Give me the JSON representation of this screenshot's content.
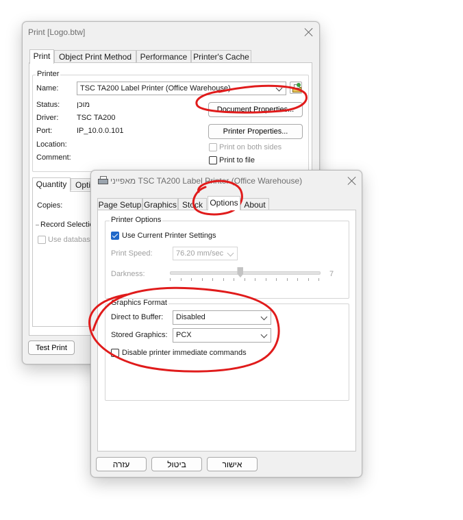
{
  "print_window": {
    "title": "Print [Logo.btw]",
    "tabs": [
      "Print",
      "Object Print Method",
      "Performance",
      "Printer's Cache"
    ],
    "printer_group": "Printer",
    "name_label": "Name:",
    "printer_name": "TSC TA200 Label Printer (Office Warehouse)",
    "status_label": "Status:",
    "status_value": "מוכן",
    "driver_label": "Driver:",
    "driver_value": "TSC TA200",
    "port_label": "Port:",
    "port_value": "IP_10.0.0.101",
    "location_label": "Location:",
    "comment_label": "Comment:",
    "document_properties": "Document Properties...",
    "printer_properties": "Printer Properties...",
    "print_both_sides": "Print on both sides",
    "print_to_file": "Print to file",
    "quantity_tab": "Quantity",
    "options_tab_partial": "Opti",
    "copies_label": "Copies:",
    "record_selection": "Record Selectio",
    "use_database": "Use database",
    "test_print": "Test Print"
  },
  "prefs_window": {
    "title": "מאפייני TSC TA200 Label Printer (Office Warehouse)",
    "tabs": [
      "Page Setup",
      "Graphics",
      "Stock",
      "Options",
      "About"
    ],
    "printer_options_group": "Printer Options",
    "use_current_settings": "Use Current Printer Settings",
    "use_current_checked": true,
    "print_speed_label": "Print Speed:",
    "print_speed_value": "76.20 mm/sec",
    "darkness_label": "Darkness:",
    "darkness_value": "7",
    "darkness_level_fraction": 0.47,
    "graphics_format_group": "Graphics Format",
    "direct_to_buffer_label": "Direct to Buffer:",
    "direct_to_buffer_value": "Disabled",
    "stored_graphics_label": "Stored Graphics:",
    "stored_graphics_value": "PCX",
    "disable_immediate": "Disable printer immediate commands",
    "ok_button": "אישור",
    "cancel_button": "ביטול",
    "help_button": "עזרה"
  },
  "colors": {
    "annotation": "#e01b1b",
    "checkbox_accent": "#1f68c9",
    "window_bg": "#f0f0f0"
  }
}
